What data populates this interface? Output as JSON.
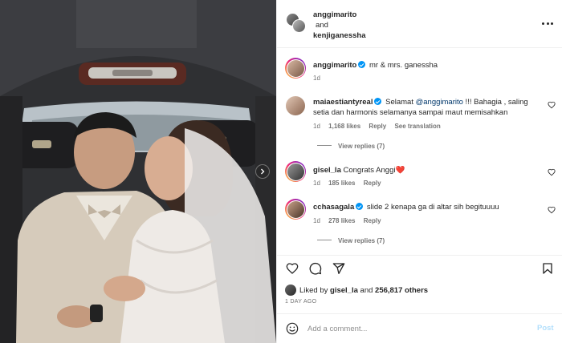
{
  "header": {
    "user1": "anggimarito",
    "and_text": "and",
    "user2": "kenjiganessha"
  },
  "caption": {
    "username": "anggimarito",
    "text": "mr & mrs. ganessha",
    "time": "1d"
  },
  "comments": [
    {
      "username": "maiaestiantyreal",
      "verified": true,
      "mention": "@anggimarito",
      "text_pre": "Selamat ",
      "text_post": " !!! Bahagia , saling setia dan harmonis selamanya sampai maut memisahkan",
      "time": "1d",
      "likes": "1,168 likes",
      "reply": "Reply",
      "translate": "See translation",
      "view_replies": "View replies (7)"
    },
    {
      "username": "gisel_la",
      "verified": false,
      "text": "Congrats Anggi❤️",
      "time": "1d",
      "likes": "185 likes",
      "reply": "Reply"
    },
    {
      "username": "cchasagala",
      "verified": true,
      "text": "slide 2 kenapa ga di altar sih begituuuu",
      "time": "1d",
      "likes": "278 likes",
      "reply": "Reply",
      "view_replies": "View replies (7)"
    }
  ],
  "likes": {
    "prefix": "Liked by ",
    "user": "gisel_la",
    "middle": " and ",
    "count": "256,817 others"
  },
  "time_ago": "1 DAY AGO",
  "add_comment": {
    "placeholder": "Add a comment...",
    "post_label": "Post"
  },
  "colors": {
    "verified": "#0095f6",
    "post_disabled": "#b2dffc",
    "mention": "#00376b"
  }
}
